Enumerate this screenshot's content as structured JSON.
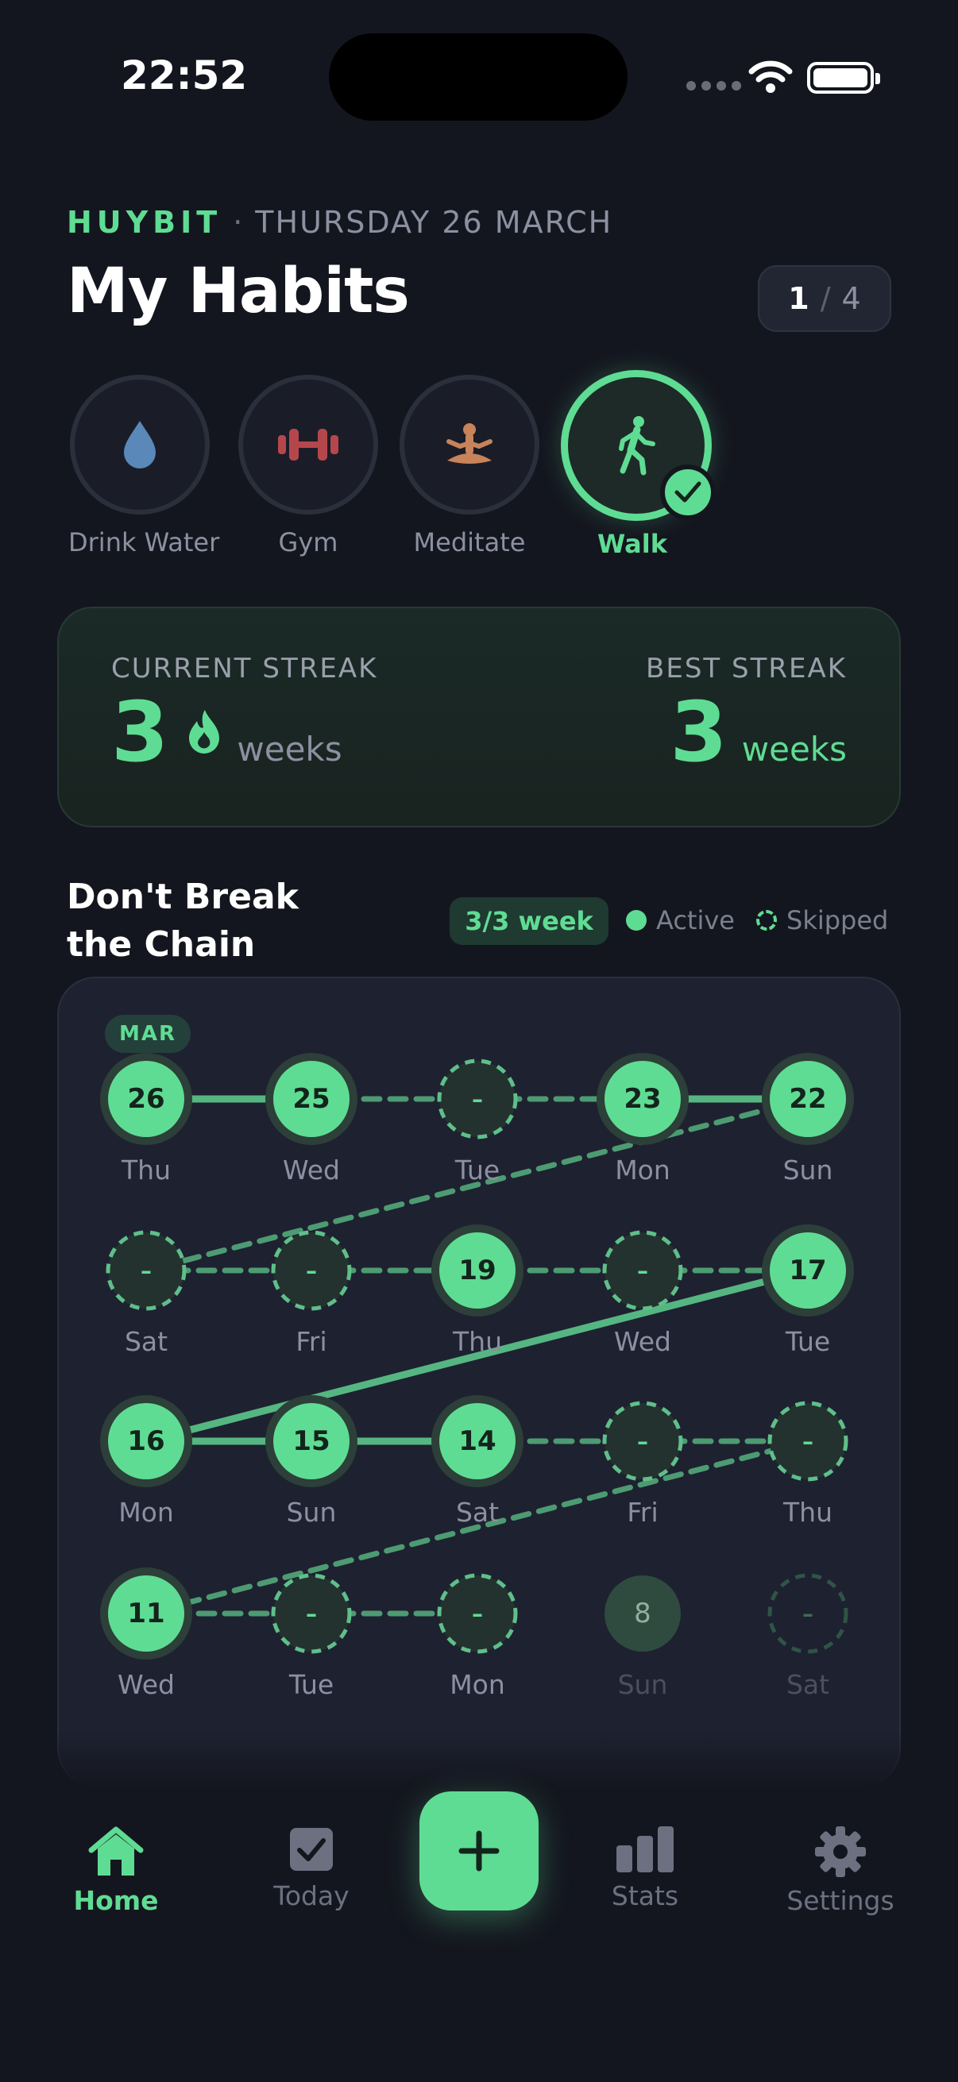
{
  "status_bar": {
    "time": "22:52"
  },
  "header": {
    "brand": "HUYBIT",
    "separator": "·",
    "date": "THURSDAY 26 MARCH",
    "title": "My Habits",
    "pager": {
      "current": "1",
      "slash": "/",
      "total": "4"
    }
  },
  "habits": [
    {
      "label": "Drink Water",
      "icon": "water-drop-icon",
      "color": "#5a88b8"
    },
    {
      "label": "Gym",
      "icon": "dumbbell-icon",
      "color": "#b5474c"
    },
    {
      "label": "Meditate",
      "icon": "meditate-icon",
      "color": "#c7835a"
    },
    {
      "label": "Walk",
      "icon": "walk-icon",
      "color": "#5fdc93",
      "selected": true,
      "completed": true
    }
  ],
  "streak": {
    "current_label": "CURRENT STREAK",
    "current_value": "3",
    "current_unit": "weeks",
    "best_label": "BEST STREAK",
    "best_value": "3",
    "best_unit": "weeks"
  },
  "chain": {
    "title_line1": "Don't Break",
    "title_line2": "the Chain",
    "week_badge": "3/3 week",
    "legend_active": "Active",
    "legend_skipped": "Skipped",
    "month": "MAR",
    "rows": [
      [
        {
          "day": "26",
          "wd": "Thu",
          "state": "active"
        },
        {
          "day": "25",
          "wd": "Wed",
          "state": "active"
        },
        {
          "day": "–",
          "wd": "Tue",
          "state": "skipped"
        },
        {
          "day": "23",
          "wd": "Mon",
          "state": "active"
        },
        {
          "day": "22",
          "wd": "Sun",
          "state": "active"
        }
      ],
      [
        {
          "day": "–",
          "wd": "Sat",
          "state": "skipped"
        },
        {
          "day": "–",
          "wd": "Fri",
          "state": "skipped"
        },
        {
          "day": "19",
          "wd": "Thu",
          "state": "active"
        },
        {
          "day": "–",
          "wd": "Wed",
          "state": "skipped"
        },
        {
          "day": "17",
          "wd": "Tue",
          "state": "active"
        }
      ],
      [
        {
          "day": "16",
          "wd": "Mon",
          "state": "active"
        },
        {
          "day": "15",
          "wd": "Sun",
          "state": "active"
        },
        {
          "day": "14",
          "wd": "Sat",
          "state": "active"
        },
        {
          "day": "–",
          "wd": "Fri",
          "state": "skipped"
        },
        {
          "day": "–",
          "wd": "Thu",
          "state": "skipped"
        }
      ],
      [
        {
          "day": "11",
          "wd": "Wed",
          "state": "active"
        },
        {
          "day": "–",
          "wd": "Tue",
          "state": "skipped"
        },
        {
          "day": "–",
          "wd": "Mon",
          "state": "skipped"
        },
        {
          "day": "8",
          "wd": "Sun",
          "state": "inactive"
        },
        {
          "day": "–",
          "wd": "Sat",
          "state": "skipped-dim"
        }
      ]
    ]
  },
  "nav": {
    "home": "Home",
    "today": "Today",
    "add": "+",
    "stats": "Stats",
    "settings": "Settings"
  },
  "colors": {
    "accent": "#5fdc93",
    "background": "#14161f",
    "card": "#1e2130",
    "muted": "#8c90a0"
  }
}
